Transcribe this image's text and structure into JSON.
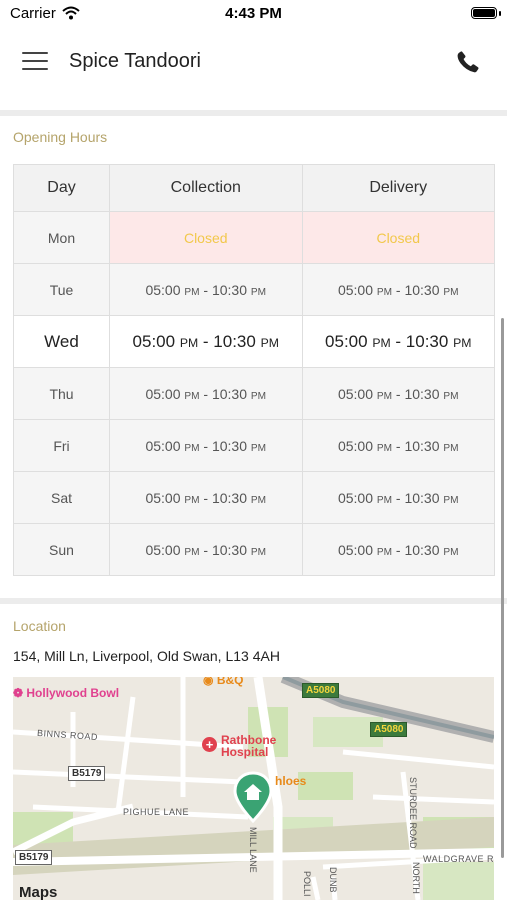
{
  "status_bar": {
    "carrier": "Carrier",
    "time": "4:43 PM"
  },
  "header": {
    "title": "Spice Tandoori"
  },
  "opening_hours": {
    "title": "Opening Hours",
    "columns": [
      "Day",
      "Collection",
      "Delivery"
    ],
    "rows": [
      {
        "day": "Mon",
        "collection": {
          "text": "Closed"
        },
        "delivery": {
          "text": "Closed"
        }
      },
      {
        "day": "Tue",
        "collection": {
          "start": "05:00",
          "start_ampm": "PM",
          "sep": " - ",
          "end": "10:30",
          "end_ampm": "PM"
        },
        "delivery": {
          "start": "05:00",
          "start_ampm": "PM",
          "sep": " - ",
          "end": "10:30",
          "end_ampm": "PM"
        }
      },
      {
        "day": "Wed",
        "collection": {
          "start": "05:00",
          "start_ampm": "PM",
          "sep": " - ",
          "end": "10:30",
          "end_ampm": "PM"
        },
        "delivery": {
          "start": "05:00",
          "start_ampm": "PM",
          "sep": " - ",
          "end": "10:30",
          "end_ampm": "PM"
        }
      },
      {
        "day": "Thu",
        "collection": {
          "start": "05:00",
          "start_ampm": "PM",
          "sep": " - ",
          "end": "10:30",
          "end_ampm": "PM"
        },
        "delivery": {
          "start": "05:00",
          "start_ampm": "PM",
          "sep": " - ",
          "end": "10:30",
          "end_ampm": "PM"
        }
      },
      {
        "day": "Fri",
        "collection": {
          "start": "05:00",
          "start_ampm": "PM",
          "sep": " - ",
          "end": "10:30",
          "end_ampm": "PM"
        },
        "delivery": {
          "start": "05:00",
          "start_ampm": "PM",
          "sep": " - ",
          "end": "10:30",
          "end_ampm": "PM"
        }
      },
      {
        "day": "Sat",
        "collection": {
          "start": "05:00",
          "start_ampm": "PM",
          "sep": " - ",
          "end": "10:30",
          "end_ampm": "PM"
        },
        "delivery": {
          "start": "05:00",
          "start_ampm": "PM",
          "sep": " - ",
          "end": "10:30",
          "end_ampm": "PM"
        }
      },
      {
        "day": "Sun",
        "collection": {
          "start": "05:00",
          "start_ampm": "PM",
          "sep": " - ",
          "end": "10:30",
          "end_ampm": "PM"
        },
        "delivery": {
          "start": "05:00",
          "start_ampm": "PM",
          "sep": " - ",
          "end": "10:30",
          "end_ampm": "PM"
        }
      }
    ]
  },
  "location": {
    "title": "Location",
    "address": "154, Mill Ln, Liverpool, Old Swan, L13 4AH",
    "map": {
      "labels": {
        "hollywood_bowl": "Hollywood Bowl",
        "bq": "B&Q",
        "binns_road": "BINNS ROAD",
        "rathbone_1": "Rathbone",
        "rathbone_2": "Hospital",
        "b5179_a": "B5179",
        "b5179_b": "B5179",
        "a5080_a": "A5080",
        "a5080_b": "A5080",
        "chloes": "hloes",
        "pighue_lane": "PIGHUE LANE",
        "mill_lane": "MILL LANE",
        "sturdee_road": "STURDEE ROAD",
        "north": "NORTH",
        "waldgrave": "WALDGRAVE R",
        "polli": "POLLI",
        "dunb": "DUNB",
        "maps": "Maps"
      }
    }
  },
  "colors": {
    "accent_label": "#b5a46b",
    "closed_bg": "#fde8e8",
    "closed_text": "#f2c84b",
    "pin": "#3aa373",
    "road_shield": "#3c7a3c"
  }
}
